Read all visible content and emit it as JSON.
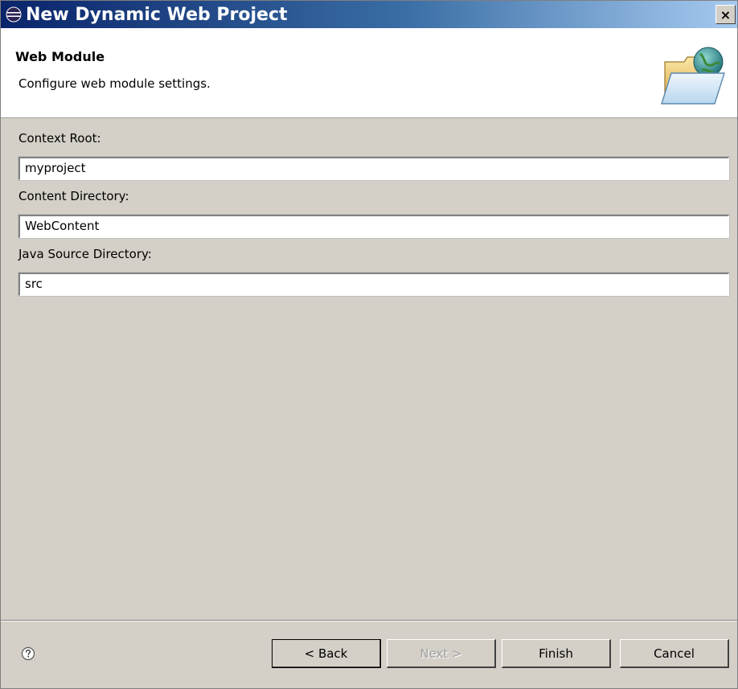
{
  "window": {
    "title": "New Dynamic Web Project",
    "close_label": "×"
  },
  "banner": {
    "title": "Web Module",
    "description": "Configure web module settings.",
    "icon": "folder-globe-icon"
  },
  "form": {
    "fields": [
      {
        "label": "Context Root:",
        "value": "myproject"
      },
      {
        "label": "Content Directory:",
        "value": "WebContent"
      },
      {
        "label": "Java Source Directory:",
        "value": "src"
      }
    ]
  },
  "footer": {
    "help_icon": "help-icon",
    "back_label": "< Back",
    "next_label": "Next >",
    "next_enabled": false,
    "finish_label": "Finish",
    "cancel_label": "Cancel"
  },
  "colors": {
    "titlebar_start": "#0a246a",
    "titlebar_end": "#a6caf0",
    "dialog_bg": "#d4d0c8",
    "banner_bg": "#ffffff"
  }
}
